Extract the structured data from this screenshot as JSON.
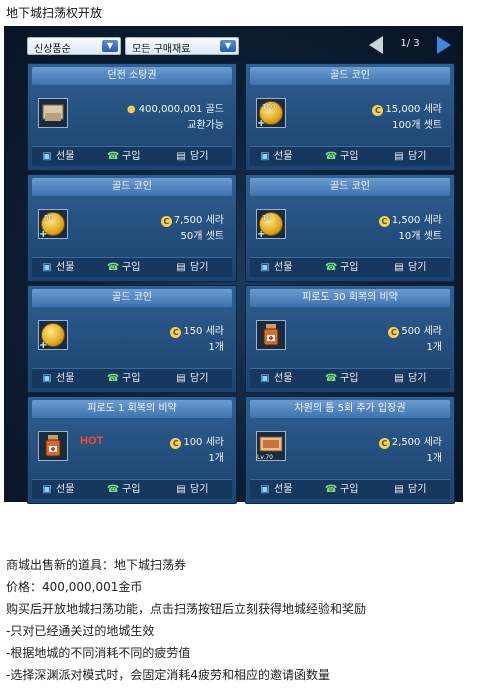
{
  "page_heading": "地下城扫荡权开放",
  "filters": {
    "category": "신상품순",
    "sort": "모든 구매재료"
  },
  "pager": {
    "text": "1/ 3"
  },
  "actions": {
    "gift": "선물",
    "buy": "구입",
    "cart": "담기"
  },
  "cards": [
    {
      "title": "던전 소탕권",
      "price": "400,000,001 골드",
      "note": "교환가능",
      "icon": "scroll-icon"
    },
    {
      "title": "골드 코인",
      "price": "15,000 세라",
      "note": "100개 셋트",
      "icon": "gold-coin-icon",
      "qty": "100"
    },
    {
      "title": "골드 코인",
      "price": "7,500 세라",
      "note": "50개 셋트",
      "icon": "gold-coin-icon",
      "qty": "50"
    },
    {
      "title": "골드 코인",
      "price": "1,500 세라",
      "note": "10개 셋트",
      "icon": "gold-coin-icon",
      "qty": "10"
    },
    {
      "title": "골드 코인",
      "price": "150 세라",
      "note": "1개",
      "icon": "gold-coin-icon"
    },
    {
      "title": "피로도 30 회복의 비약",
      "price": "500 세라",
      "note": "1개",
      "icon": "potion-icon"
    },
    {
      "title": "피로도 1 회복의 비약",
      "price": "100 세라",
      "note": "1개",
      "icon": "potion-icon",
      "badge": "HOT"
    },
    {
      "title": "차원의 틈 5회 추가 입장권",
      "price": "2,500 세라",
      "note": "1개",
      "icon": "ticket-icon",
      "level": "Lv.70"
    }
  ],
  "description": {
    "line1": "商城出售新的道具：地下城扫荡券",
    "line2": "价格：400,000,001金币",
    "line3": "购买后开放地城扫荡功能，点击扫荡按钮后立刻获得地城经验和奖励",
    "line4": "-只对已经通关过的地城生效",
    "line5": "-根据地城的不同消耗不同的疲劳值",
    "line6": "-选择深渊派对模式时，会固定消耗4疲劳和相应的邀请函数量"
  }
}
